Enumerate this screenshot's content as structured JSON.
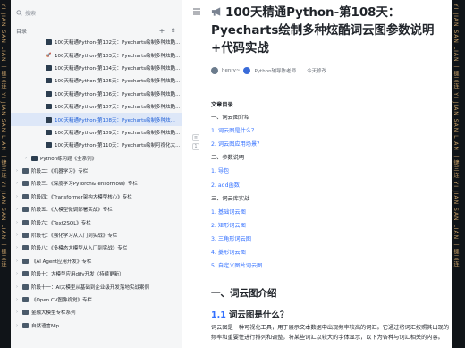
{
  "edge": {
    "left_text": "YI JIAN SAN LIAN 一键三连 YI JIAN SAN LIAN 一键三连 YI JIAN SAN LIAN 一键三连",
    "right_text": "YI JIAN SAN LIAN 一键三连 YI JIAN SAN LIAN 一键三连 YI JIAN SAN LIAN 一键三连"
  },
  "sidebar": {
    "search_placeholder": "搜索",
    "section_label": "目录",
    "items": [
      {
        "label": "100天精通Python-第102天：Pyecharts绘制多种炫酷...",
        "level": 2,
        "caret": "",
        "icon": "thumb"
      },
      {
        "label": "100天精通Python-第103天：Pyecharts绘制多种炫酷...",
        "level": 2,
        "caret": "",
        "icon": "rocket"
      },
      {
        "label": "100天精通Python-第104天：Pyecharts绘制多种炫酷...",
        "level": 2,
        "caret": "",
        "icon": "thumb"
      },
      {
        "label": "100天精通Python-第105天：Pyecharts绘制多种炫酷...",
        "level": 2,
        "caret": "",
        "icon": "thumb"
      },
      {
        "label": "100天精通Python-第106天：Pyecharts绘制多种炫酷...",
        "level": 2,
        "caret": "",
        "icon": "thumb"
      },
      {
        "label": "100天精通Python-第107天：Pyecharts绘制多种炫酷...",
        "level": 2,
        "caret": "",
        "icon": "thumb"
      },
      {
        "label": "100天精通Python-第108天：Pyecharts绘制多种炫...",
        "level": 2,
        "caret": "",
        "icon": "thumb",
        "selected": true
      },
      {
        "label": "100天精通Python-第109天：Pyecharts绘制多种炫酷...",
        "level": 2,
        "caret": "",
        "icon": "thumb"
      },
      {
        "label": "100天精通Python-第110天：Pyecharts绘制可视化大...",
        "level": 2,
        "caret": "",
        "icon": "thumb"
      },
      {
        "label": "Python练习题《全系列》",
        "level": 1,
        "caret": "›",
        "icon": "thumb"
      },
      {
        "label": "阶段二：《机器学习》专栏",
        "level": 0,
        "caret": "›",
        "icon": "book"
      },
      {
        "label": "阶段三：《深度学习PyTorch&TensorFlow》专栏",
        "level": 0,
        "caret": "›",
        "icon": "book"
      },
      {
        "label": "阶段四：《Transformer架构大模型核心》专栏",
        "level": 0,
        "caret": "›",
        "icon": "book"
      },
      {
        "label": "阶段五：《大模型微调部署实战》专栏",
        "level": 0,
        "caret": "›",
        "icon": "book"
      },
      {
        "label": "阶段六：《Text2SQL》专栏",
        "level": 0,
        "caret": "›",
        "icon": "book"
      },
      {
        "label": "阶段七：《强化学习从入门到实战》专栏",
        "level": 0,
        "caret": "›",
        "icon": "book"
      },
      {
        "label": "阶段八：《多模态大模型从入门到实战》专栏",
        "level": 0,
        "caret": "›",
        "icon": "book"
      },
      {
        "label": "《AI Agent应用开发》专栏",
        "level": 0,
        "caret": "›",
        "icon": "book"
      },
      {
        "label": "阶段十：大模型应用dify开发（持续更新）",
        "level": 0,
        "caret": "›",
        "icon": "book"
      },
      {
        "label": "阶段十一：AI大模型从基础到企业级开发落地实战案例",
        "level": 0,
        "caret": "›",
        "icon": "book"
      },
      {
        "label": "《Open CV图像视觉》专栏",
        "level": 0,
        "caret": "›",
        "icon": "book"
      },
      {
        "label": "金融大模型专栏系列",
        "level": 0,
        "caret": "›",
        "icon": "book"
      },
      {
        "label": "自然语言Nlp",
        "level": 0,
        "caret": "›",
        "icon": "book"
      }
    ]
  },
  "doc": {
    "title": "100天精通Python-第108天：Pyecharts绘制多种炫酷词云图参数说明+代码实战",
    "author": "henry~",
    "coauthor": "Python辅导陈老师",
    "modified": "今天修改",
    "toc_title": "文章目录",
    "toc": [
      {
        "text": "一、词云图介绍",
        "cls": "lvl1"
      },
      {
        "text": "1. 词云图是什么？",
        "cls": "sub"
      },
      {
        "text": "2. 词云图应用场景？",
        "cls": "sub"
      },
      {
        "text": "二、参数说明",
        "cls": "lvl1"
      },
      {
        "text": "1. 导包",
        "cls": "sub"
      },
      {
        "text": "2. add函数",
        "cls": "sub"
      },
      {
        "text": "三、词云库实战",
        "cls": "lvl1"
      },
      {
        "text": "1. 基础词云图",
        "cls": "sub"
      },
      {
        "text": "2. 矩形词云图",
        "cls": "sub"
      },
      {
        "text": "3. 三角形词云图",
        "cls": "sub"
      },
      {
        "text": "4. 菱形词云图",
        "cls": "sub"
      },
      {
        "text": "5. 自定义图片词云图",
        "cls": "sub"
      }
    ],
    "h1": "一、词云图介绍",
    "h2_num": "1.1",
    "h2": "词云图是什么？",
    "para": "词云图是一种可视化工具，用于展示文本数据中出现频率较高的词汇。它通过将词汇按照其出现的频率和重要性进行排列和调整，将某些词汇以较大的字体显示，以下为各种与词汇相关的内容。"
  }
}
